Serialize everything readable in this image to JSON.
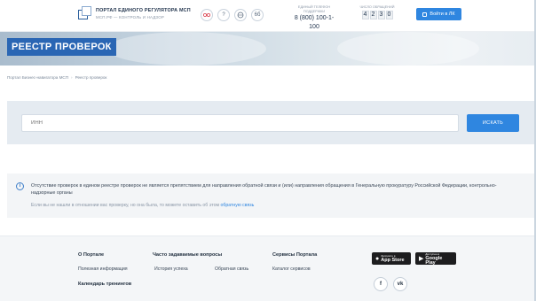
{
  "header": {
    "logo_title": "ПОРТАЛ ЕДИНОГО РЕГУЛЯТОРА МСП",
    "logo_subtitle": "МСП.РФ — КОНТРОЛЬ И НАДЗОР",
    "circle_buttons": [
      {
        "icon": "glasses-icon",
        "label": "◎◎"
      },
      {
        "icon": "question-icon",
        "label": "?"
      },
      {
        "icon": "globe-icon",
        "label": "◌"
      },
      {
        "icon": "vision-icon",
        "label": "6б"
      }
    ],
    "phone_label": "ЕДИНЫЙ ТЕЛЕФОН ПОДДЕРЖКИ",
    "phone_number": "8 (800) 100-1-100",
    "counter_label": "ЧИСЛО ОБРАЩЕНИЙ",
    "counter_digits": [
      "4",
      "2",
      "3",
      "0"
    ],
    "login_label": "Войти в ЛК"
  },
  "hero": {
    "title": "РЕЕСТР ПРОВЕРОК"
  },
  "breadcrumb": {
    "home": "Портал Бизнес-навигатора МСП",
    "separator": "›",
    "current": "Реестр проверок"
  },
  "search": {
    "placeholder": "ИНН",
    "button_label": "ИСКАТЬ"
  },
  "info": {
    "text": "Отсутствие проверок в едином реестре проверок не является препятствием для направления обратной связи и (или) направления обращения в Генеральную прокуратуру Российской Федерации, контрольно-надзорные органы",
    "note": "Если вы не нашли в отношении вас проверку, но она была, то можете оставить об этом",
    "note_link": "обратную связь"
  },
  "footer": {
    "col1": {
      "heading": "О Портале",
      "links": [
        "Полезная информация",
        "Календарь тренингов"
      ]
    },
    "col2": {
      "heading": "Часто задаваемые вопросы",
      "links": [
        "История успеха",
        "Обратная связь"
      ]
    },
    "col3": {
      "heading": "Сервисы Портала",
      "links": [
        "Каталог сервисов"
      ]
    },
    "appstore": {
      "small": "Загрузите в",
      "big": "App Store"
    },
    "googleplay": {
      "small": "Доступно в",
      "big": "Google Play"
    },
    "social": [
      {
        "icon": "facebook-icon",
        "label": "f"
      },
      {
        "icon": "vk-icon",
        "label": "vk"
      }
    ]
  },
  "colors": {
    "accent": "#2f86e0",
    "hero_title_bg": "#2a66b4",
    "search_band": "#e5ebf1"
  }
}
